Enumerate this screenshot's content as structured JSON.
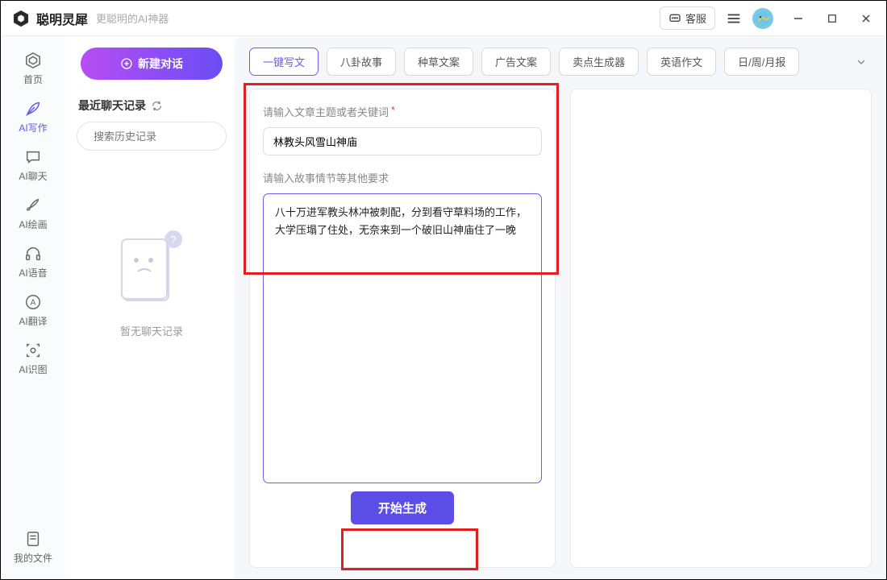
{
  "titlebar": {
    "appName": "聪明灵犀",
    "appSub": "更聪明的AI神器",
    "support": "客服"
  },
  "sidebar": {
    "items": [
      {
        "label": "首页"
      },
      {
        "label": "AI写作"
      },
      {
        "label": "AI聊天"
      },
      {
        "label": "AI绘画"
      },
      {
        "label": "AI语音"
      },
      {
        "label": "AI翻译"
      },
      {
        "label": "AI识图"
      }
    ],
    "bottom": {
      "label": "我的文件"
    }
  },
  "history": {
    "newChat": "新建对话",
    "title": "最近聊天记录",
    "searchPlaceholder": "搜索历史记录",
    "empty": "暂无聊天记录"
  },
  "tabs": [
    "一键写文",
    "八卦故事",
    "种草文案",
    "广告文案",
    "卖点生成器",
    "英语作文",
    "日/周/月报"
  ],
  "form": {
    "label1": "请输入文章主题或者关键词",
    "required": "*",
    "topicValue": "林教头风雪山神庙",
    "label2": "请输入故事情节等其他要求",
    "plotValue": "八十万进军教头林冲被刺配，分到看守草料场的工作，大学压塌了住处，无奈来到一个破旧山神庙住了一晚",
    "generate": "开始生成"
  }
}
